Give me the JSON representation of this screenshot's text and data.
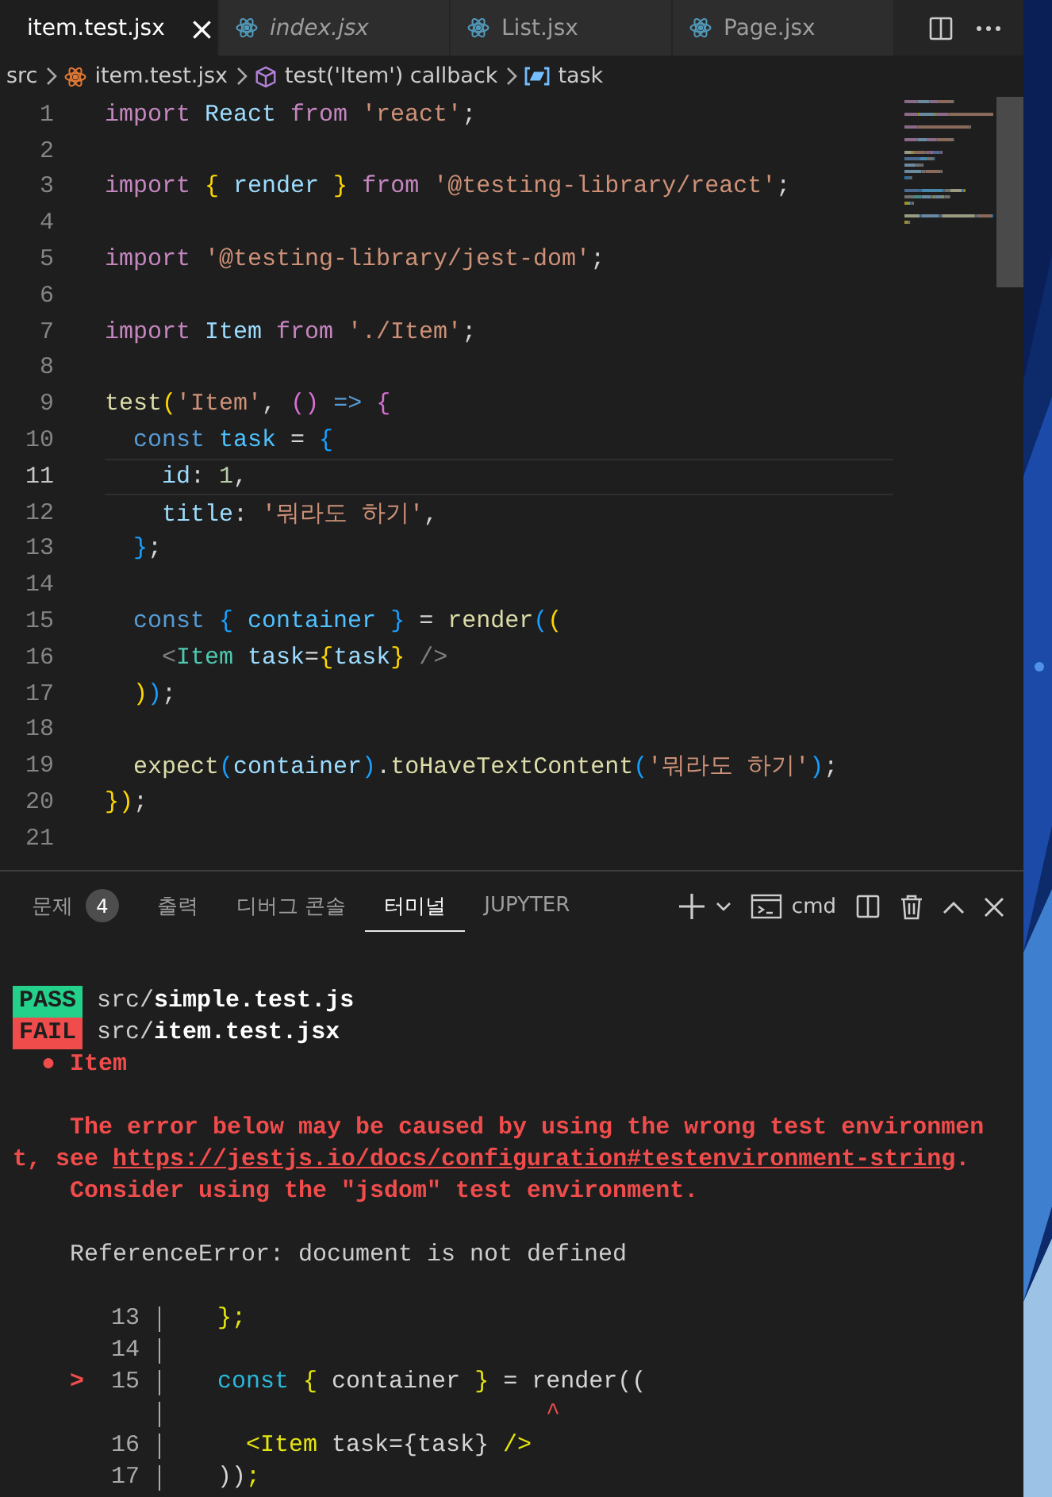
{
  "tabs": [
    {
      "label": "item.test.jsx",
      "selected": true,
      "preview": false,
      "close": "×"
    },
    {
      "label": "index.jsx",
      "selected": false,
      "preview": true
    },
    {
      "label": "List.jsx",
      "selected": false,
      "preview": false
    },
    {
      "label": "Page.jsx",
      "selected": false,
      "preview": false
    }
  ],
  "breadcrumbs": [
    {
      "kind": "folder",
      "label": "src"
    },
    {
      "kind": "file",
      "label": "item.test.jsx"
    },
    {
      "kind": "function",
      "label": "test('Item') callback"
    },
    {
      "kind": "variable",
      "label": "task"
    }
  ],
  "code_lines": [
    {
      "number": "1",
      "current": false,
      "tokens": [
        {
          "kind": "kw",
          "text": "import "
        },
        {
          "kind": "var",
          "text": "React "
        },
        {
          "kind": "kw",
          "text": "from "
        },
        {
          "kind": "str",
          "text": "'react'"
        },
        {
          "kind": "p",
          "text": ";"
        }
      ]
    },
    {
      "number": "2",
      "current": false
    },
    {
      "number": "3",
      "current": false,
      "tokens": [
        {
          "kind": "kw",
          "text": "import "
        },
        {
          "kind": "b1",
          "text": "{"
        },
        {
          "kind": "var",
          "text": " render "
        },
        {
          "kind": "b1",
          "text": "}"
        },
        {
          "kind": "kw",
          "text": " from "
        },
        {
          "kind": "str",
          "text": "'@testing-library/react'"
        },
        {
          "kind": "p",
          "text": ";"
        }
      ]
    },
    {
      "number": "4",
      "current": false
    },
    {
      "number": "5",
      "current": false,
      "tokens": [
        {
          "kind": "kw",
          "text": "import "
        },
        {
          "kind": "str",
          "text": "'@testing-library/jest-dom'"
        },
        {
          "kind": "p",
          "text": ";"
        }
      ]
    },
    {
      "number": "6",
      "current": false
    },
    {
      "number": "7",
      "current": false,
      "tokens": [
        {
          "kind": "kw",
          "text": "import "
        },
        {
          "kind": "var",
          "text": "Item "
        },
        {
          "kind": "kw",
          "text": "from "
        },
        {
          "kind": "str",
          "text": "'./Item'"
        },
        {
          "kind": "p",
          "text": ";"
        }
      ]
    },
    {
      "number": "8",
      "current": false
    },
    {
      "number": "9",
      "current": false,
      "tokens": [
        {
          "kind": "fn",
          "text": "test"
        },
        {
          "kind": "b1",
          "text": "("
        },
        {
          "kind": "str",
          "text": "'Item'"
        },
        {
          "kind": "p",
          "text": ", "
        },
        {
          "kind": "b2",
          "text": "()"
        },
        {
          "kind": "ctl",
          "text": " => "
        },
        {
          "kind": "b2",
          "text": "{"
        }
      ]
    },
    {
      "number": "10",
      "current": false,
      "tokens": [
        {
          "kind": "ctl",
          "text": "  const "
        },
        {
          "kind": "cvar",
          "text": "task"
        },
        {
          "kind": "p",
          "text": " = "
        },
        {
          "kind": "b3",
          "text": "{"
        }
      ]
    },
    {
      "number": "11",
      "current": true,
      "tokens": [
        {
          "kind": "var",
          "text": "    id"
        },
        {
          "kind": "p",
          "text": ": "
        },
        {
          "kind": "num",
          "text": "1"
        },
        {
          "kind": "p",
          "text": ","
        }
      ]
    },
    {
      "number": "12",
      "current": false,
      "tokens": [
        {
          "kind": "var",
          "text": "    title"
        },
        {
          "kind": "p",
          "text": ": "
        },
        {
          "kind": "str",
          "text": "'뭐라도 하기'"
        },
        {
          "kind": "p",
          "text": ","
        }
      ]
    },
    {
      "number": "13",
      "current": false,
      "tokens": [
        {
          "kind": "b3",
          "text": "  }"
        },
        {
          "kind": "p",
          "text": ";"
        }
      ]
    },
    {
      "number": "14",
      "current": false
    },
    {
      "number": "15",
      "current": false,
      "tokens": [
        {
          "kind": "ctl",
          "text": "  const "
        },
        {
          "kind": "b3",
          "text": "{"
        },
        {
          "kind": "cvar",
          "text": " container "
        },
        {
          "kind": "b3",
          "text": "}"
        },
        {
          "kind": "p",
          "text": " = "
        },
        {
          "kind": "fn",
          "text": "render"
        },
        {
          "kind": "b3",
          "text": "("
        },
        {
          "kind": "b1",
          "text": "("
        }
      ]
    },
    {
      "number": "16",
      "current": false,
      "tokens": [
        {
          "kind": "tag",
          "text": "    <"
        },
        {
          "kind": "comp",
          "text": "Item"
        },
        {
          "kind": "var",
          "text": " task"
        },
        {
          "kind": "p",
          "text": "="
        },
        {
          "kind": "b1",
          "text": "{"
        },
        {
          "kind": "var",
          "text": "task"
        },
        {
          "kind": "b1",
          "text": "}"
        },
        {
          "kind": "tag",
          "text": " />"
        }
      ]
    },
    {
      "number": "17",
      "current": false,
      "tokens": [
        {
          "kind": "b1",
          "text": "  )"
        },
        {
          "kind": "b3",
          "text": ")"
        },
        {
          "kind": "p",
          "text": ";"
        }
      ]
    },
    {
      "number": "18",
      "current": false
    },
    {
      "number": "19",
      "current": false,
      "tokens": [
        {
          "kind": "fn",
          "text": "  expect"
        },
        {
          "kind": "b3",
          "text": "("
        },
        {
          "kind": "var",
          "text": "container"
        },
        {
          "kind": "b3",
          "text": ")"
        },
        {
          "kind": "p",
          "text": "."
        },
        {
          "kind": "fn",
          "text": "toHaveTextContent"
        },
        {
          "kind": "b3",
          "text": "("
        },
        {
          "kind": "str",
          "text": "'뭐라도 하기'"
        },
        {
          "kind": "b3",
          "text": ")"
        },
        {
          "kind": "p",
          "text": ";"
        }
      ]
    },
    {
      "number": "20",
      "current": false,
      "tokens": [
        {
          "kind": "b1",
          "text": "})"
        },
        {
          "kind": "p",
          "text": ";"
        }
      ]
    },
    {
      "number": "21",
      "current": false
    }
  ],
  "panel_tabs": [
    {
      "label": "문제",
      "badge": "4",
      "selected": false
    },
    {
      "label": "출력",
      "selected": false
    },
    {
      "label": "디버그 콘솔",
      "selected": false
    },
    {
      "label": "터미널",
      "selected": true
    },
    {
      "label": "JUPYTER",
      "selected": false
    }
  ],
  "terminal_profile": "cmd",
  "terminal": [
    {
      "kind": "result",
      "badge": "PASS",
      "passed": true,
      "path": "src/**simple.test.js**"
    },
    {
      "kind": "result",
      "badge": "FAIL",
      "passed": false,
      "path": "src/**item.test.jsx**"
    },
    {
      "kind": "error",
      "text": "  ● Item"
    },
    {
      "kind": "blank"
    },
    {
      "kind": "error",
      "text": "    The error below may be caused by using the wrong test environmen"
    },
    {
      "kind": "link_line",
      "before": "t, see ",
      "link": "https://jestjs.io/docs/configuration#testenvironment-string",
      "after": "."
    },
    {
      "kind": "error",
      "text": "    Consider using the \"jsdom\" test environment."
    },
    {
      "kind": "blank"
    },
    {
      "kind": "plain",
      "text": "    ReferenceError: document is not defined"
    },
    {
      "kind": "blank"
    },
    {
      "kind": "excerpt",
      "number": "13",
      "tokens": [
        {
          "kind": "y",
          "text": "  };"
        }
      ]
    },
    {
      "kind": "excerpt",
      "number": "14"
    },
    {
      "kind": "excerpt",
      "marker": ">",
      "number": "15",
      "tokens": [
        {
          "kind": "c",
          "text": "  const "
        },
        {
          "kind": "y",
          "text": "{"
        },
        {
          "kind": "p",
          "text": " container "
        },
        {
          "kind": "y",
          "text": "}"
        },
        {
          "kind": "p",
          "text": " = render(("
        }
      ]
    },
    {
      "kind": "caret",
      "text": "                         ^"
    },
    {
      "kind": "excerpt",
      "number": "16",
      "tokens": [
        {
          "kind": "y",
          "text": "    <Item"
        },
        {
          "kind": "p",
          "text": " task={task} "
        },
        {
          "kind": "y",
          "text": "/>"
        }
      ]
    },
    {
      "kind": "excerpt",
      "number": "17",
      "tokens": [
        {
          "kind": "p",
          "text": "  ))"
        },
        {
          "kind": "y",
          "text": ";"
        }
      ]
    }
  ]
}
